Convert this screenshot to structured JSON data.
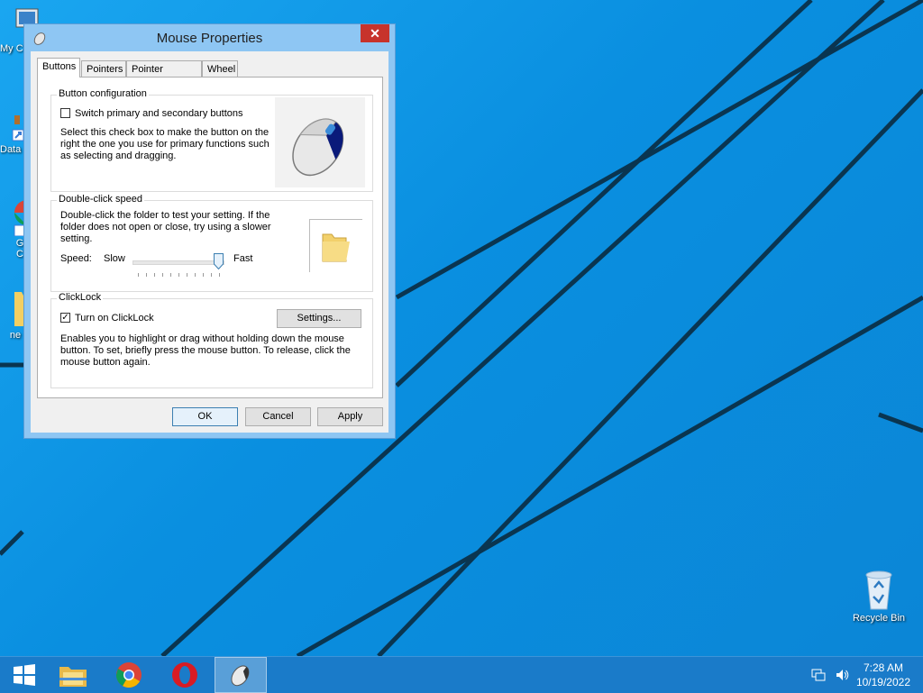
{
  "desktop": {
    "icons": [
      {
        "label": "My C",
        "icon": "computer-icon"
      },
      {
        "label": "Data",
        "icon": "shortcut-icon"
      },
      {
        "label": "G\nC",
        "icon": "chrome-icon"
      },
      {
        "label": "ne",
        "icon": "folder-icon"
      },
      {
        "label": "Recycle Bin",
        "icon": "recycle-bin-icon"
      }
    ]
  },
  "dialog": {
    "title": "Mouse Properties",
    "close_label": "✕",
    "tabs": [
      "Buttons",
      "Pointers",
      "Pointer Options",
      "Wheel"
    ],
    "active_tab": "Buttons",
    "button_config": {
      "group_label": "Button configuration",
      "checkbox_label": "Switch primary and secondary buttons",
      "checked": false,
      "description": "Select this check box to make the button on the right the one you use for primary functions such as selecting and dragging."
    },
    "double_click": {
      "group_label": "Double-click speed",
      "description": "Double-click the folder to test your setting. If the folder does not open or close, try using a slower setting.",
      "speed_label": "Speed:",
      "slow_label": "Slow",
      "fast_label": "Fast",
      "slider_value": 0.95
    },
    "clicklock": {
      "group_label": "ClickLock",
      "checkbox_label": "Turn on ClickLock",
      "checked": true,
      "settings_label": "Settings...",
      "description": "Enables you to highlight or drag without holding down the mouse button. To set, briefly press the mouse button. To release, click the mouse button again."
    },
    "buttons": {
      "ok": "OK",
      "cancel": "Cancel",
      "apply": "Apply"
    }
  },
  "taskbar": {
    "items": [
      "start-icon",
      "file-explorer-icon",
      "chrome-icon",
      "opera-icon",
      "mouse-icon"
    ],
    "time": "7:28 AM",
    "date": "10/19/2022"
  },
  "colors": {
    "desktop": "#0f9bea",
    "taskbar": "#1a7bc9",
    "dialog_frame": "#8ec6f3",
    "close": "#c7332b"
  }
}
